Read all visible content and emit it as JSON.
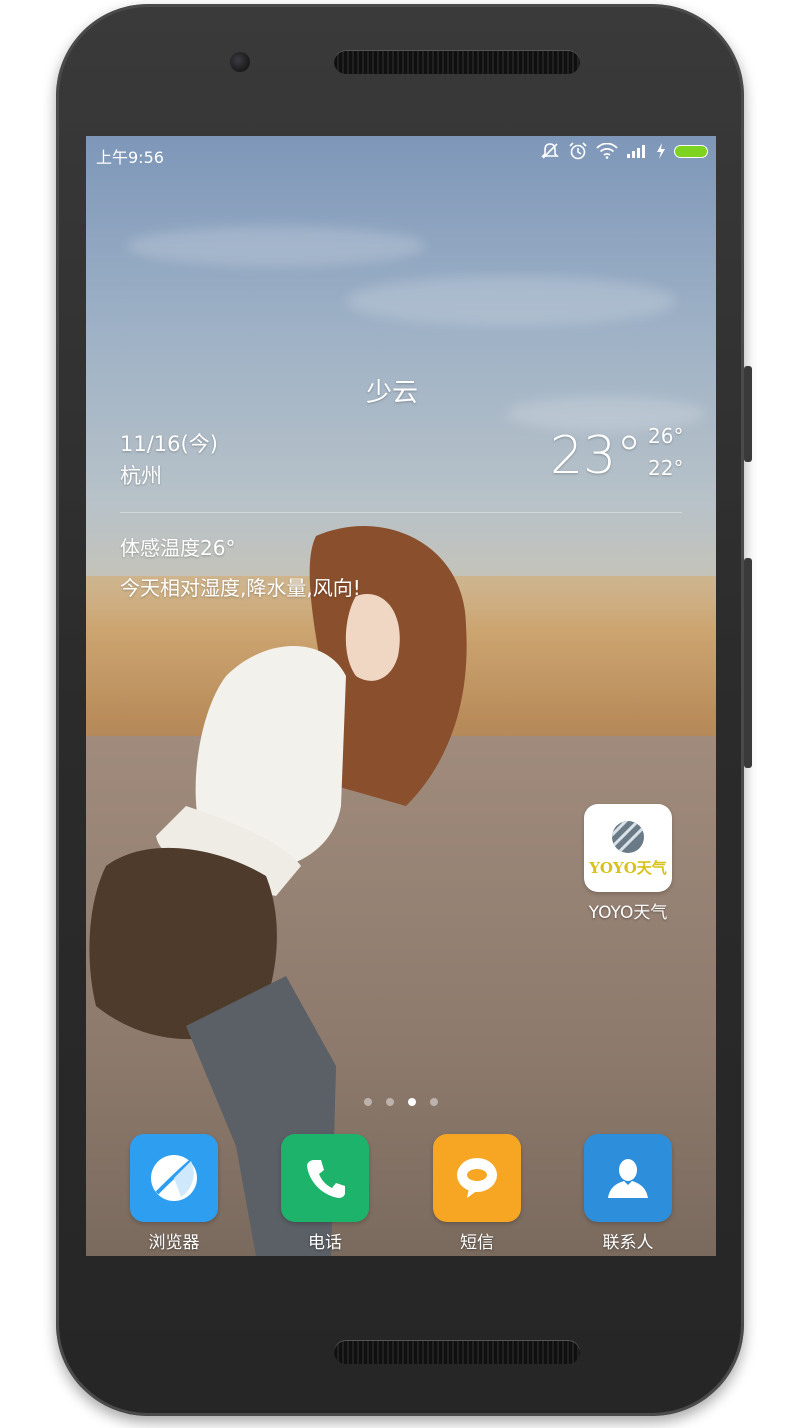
{
  "status_bar": {
    "time": "上午9:56",
    "icons": [
      "silent-icon",
      "alarm-icon",
      "wifi-icon",
      "signal-icon",
      "charging-icon",
      "battery-icon"
    ],
    "battery_color": "#7ed321"
  },
  "weather_widget": {
    "condition": "少云",
    "date": "11/16(今)",
    "city": "杭州",
    "temperature": "23°",
    "high": "26°",
    "low": "22°",
    "feels_like": "体感温度26°",
    "tip": "今天相对湿度,降水量,风向!"
  },
  "desktop_app": {
    "label": "YOYO天气",
    "logo_text": "YOYO天气"
  },
  "page_indicator": {
    "count": 4,
    "active_index": 2
  },
  "dock": [
    {
      "label": "浏览器",
      "icon": "browser-icon",
      "color": "#2e9ff0"
    },
    {
      "label": "电话",
      "icon": "phone-icon",
      "color": "#1db36a"
    },
    {
      "label": "短信",
      "icon": "message-icon",
      "color": "#f6a623"
    },
    {
      "label": "联系人",
      "icon": "contact-icon",
      "color": "#2d8fdb"
    }
  ]
}
